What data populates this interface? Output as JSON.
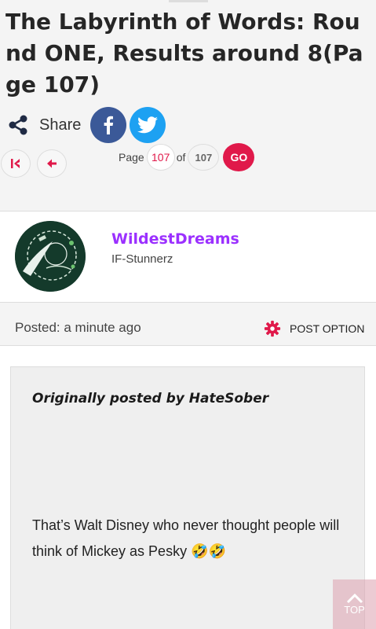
{
  "thread": {
    "title": "The Labyrinth of Words: Round ONE, Results around 8(Page 107)"
  },
  "share": {
    "label": "Share",
    "icons": [
      "share-icon",
      "facebook-icon",
      "twitter-icon"
    ]
  },
  "pagination": {
    "page_label": "Page",
    "current_page": "107",
    "of_label": "of",
    "total_pages": "107",
    "go_label": "GO",
    "first_icon": "first-page-icon",
    "prev_icon": "prev-page-icon"
  },
  "post": {
    "username": "WildestDreams",
    "user_group": "IF-Stunnerz",
    "posted_label": "Posted: a minute ago",
    "option_label": "POST OPTION",
    "quote_author": "Originally posted by HateSober",
    "quote_text": "That’s Walt Disney who never thought people will think of Mickey as Pesky 🤣🤣"
  },
  "scroll_top": {
    "label": "TOP"
  },
  "colors": {
    "accent": "#e0194a",
    "username": "#9b30ff",
    "facebook": "#3b5998",
    "twitter": "#1da1f2"
  }
}
